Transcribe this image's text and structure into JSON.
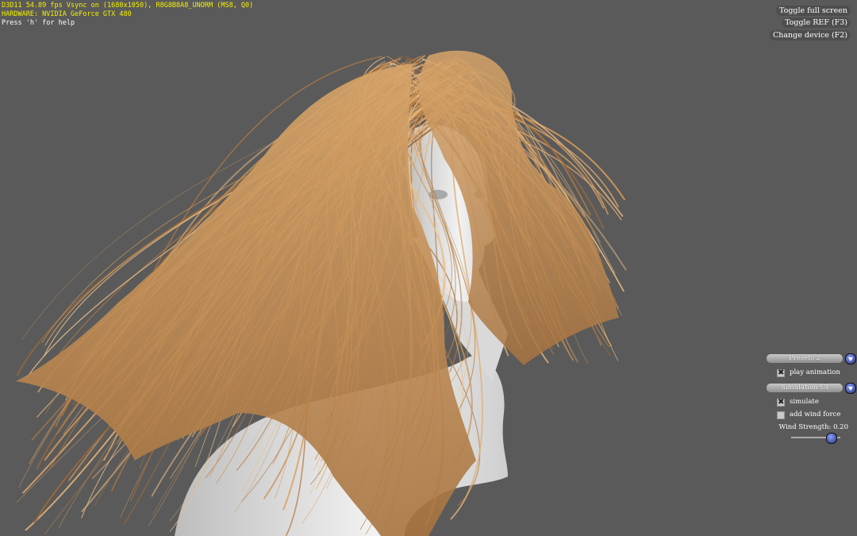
{
  "stats": {
    "line1": "D3D11 54.89 fps Vsync on (1680x1050), R8G8B8A8_UNORM (MS8, Q0)",
    "line2": "HARDWARE: NVIDIA GeForce GTX 480",
    "line3": "Press 'h' for help"
  },
  "top_buttons": {
    "fullscreen": "Toggle full screen",
    "ref": "Toggle REF (F3)",
    "device": "Change device (F2)"
  },
  "panel": {
    "presets_label": "Presets 2",
    "play_animation_label": "play animation",
    "play_animation_checked": true,
    "simulation_ui_label": "Simulation UI",
    "simulate_label": "simulate",
    "simulate_checked": true,
    "wind_force_label": "add wind force",
    "wind_force_checked": false,
    "wind_strength_label": "Wind Strength: 0.20",
    "wind_strength_value": 0.8
  },
  "colors": {
    "background": "#5a5a5a",
    "stats_text": "#f4f000",
    "hair": "#c9955a",
    "skin": "#e6e6e6"
  }
}
